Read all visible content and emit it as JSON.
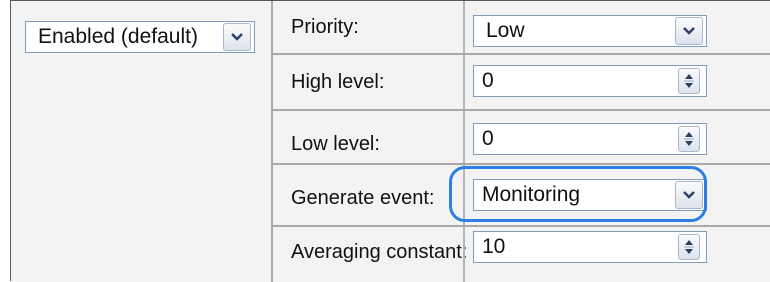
{
  "state_combo": {
    "value": "Enabled (default)"
  },
  "rows": [
    {
      "label": "Priority:",
      "value": "Low",
      "control": "dropdown"
    },
    {
      "label": "High level:",
      "value": "0",
      "control": "spinner"
    },
    {
      "label": "Low level:",
      "value": "0",
      "control": "spinner"
    },
    {
      "label": "Generate event:",
      "value": "Monitoring",
      "control": "dropdown"
    },
    {
      "label": "Averaging constant:",
      "value": "10",
      "control": "spinner"
    }
  ],
  "icons": {
    "dropdown": "chevron-down-icon",
    "spinner": "spin-up-down-icon"
  },
  "colors": {
    "highlight": "#2d7fe6",
    "field_border": "#7f9db9"
  }
}
